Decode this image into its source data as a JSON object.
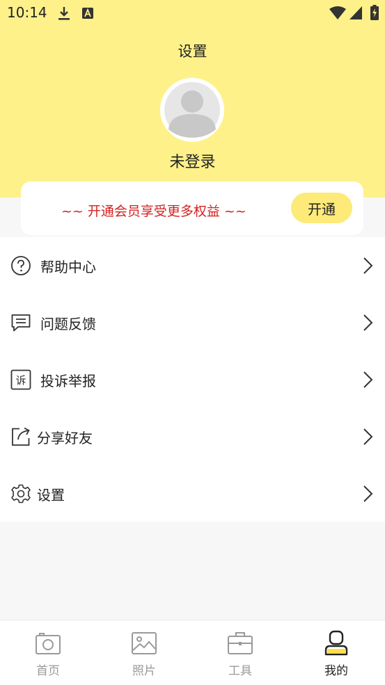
{
  "status_bar": {
    "time": "10:14"
  },
  "header": {
    "title": "设置",
    "login_status": "未登录"
  },
  "vip": {
    "promo_text": "~~ 开通会员享受更多权益 ~~",
    "button_label": "开通",
    "accent_color": "#d42020"
  },
  "menu": {
    "items": [
      {
        "label": "帮助中心",
        "icon": "help-circle-icon"
      },
      {
        "label": "问题反馈",
        "icon": "message-icon"
      },
      {
        "label": "投诉举报",
        "icon": "complaint-icon"
      },
      {
        "label": "分享好友",
        "icon": "share-icon"
      },
      {
        "label": "设置",
        "icon": "gear-icon"
      }
    ]
  },
  "tabbar": {
    "tabs": [
      {
        "label": "首页",
        "icon": "camera-icon",
        "active": false
      },
      {
        "label": "照片",
        "icon": "image-icon",
        "active": false
      },
      {
        "label": "工具",
        "icon": "toolbox-icon",
        "active": false
      },
      {
        "label": "我的",
        "icon": "user-icon",
        "active": true
      }
    ]
  },
  "colors": {
    "header_bg": "#fef18a",
    "button_bg": "#fdea78"
  }
}
